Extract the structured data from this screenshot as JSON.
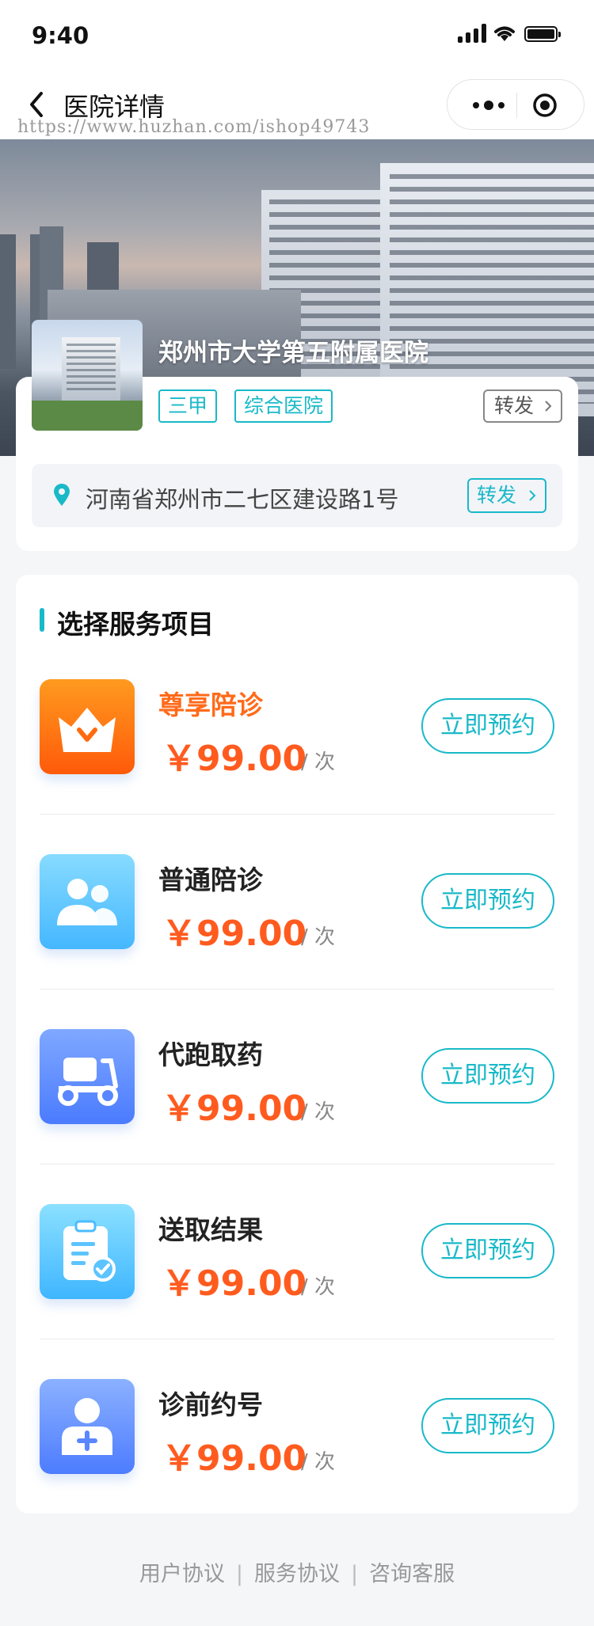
{
  "status_bar": {
    "time": "9:40"
  },
  "nav": {
    "title": "医院详情"
  },
  "watermark": "https://www.huzhan.com/ishop49743",
  "hospital": {
    "name": "郑州市大学第五附属医院",
    "tags": [
      "三甲",
      "综合医院"
    ],
    "share_label": "转发",
    "address": "河南省郑州市二七区建设路1号",
    "address_action": "转发"
  },
  "services_section": {
    "title": "选择服务项目",
    "items": [
      {
        "name": "尊享陪诊",
        "price": "￥99.00",
        "unit": "/ 次",
        "button": "立即预约",
        "icon": "crown-icon"
      },
      {
        "name": "普通陪诊",
        "price": "￥99.00",
        "unit": "/ 次",
        "button": "立即预约",
        "icon": "people-icon"
      },
      {
        "name": "代跑取药",
        "price": "￥99.00",
        "unit": "/ 次",
        "button": "立即预约",
        "icon": "scooter-icon"
      },
      {
        "name": "送取结果",
        "price": "￥99.00",
        "unit": "/ 次",
        "button": "立即预约",
        "icon": "clipboard-check-icon"
      },
      {
        "name": "诊前约号",
        "price": "￥99.00",
        "unit": "/ 次",
        "button": "立即预约",
        "icon": "doctor-icon"
      }
    ]
  },
  "footer": {
    "links": [
      "用户协议",
      "服务协议",
      "咨询客服"
    ],
    "separator": "|"
  },
  "colors": {
    "accent": "#19b9c8",
    "price": "#ff5b1f",
    "vip": "#ff6a1a"
  }
}
